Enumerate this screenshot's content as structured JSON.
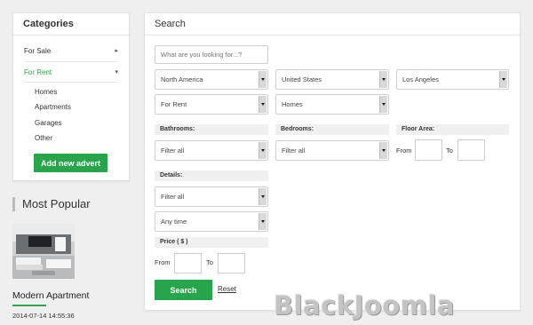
{
  "categories": {
    "title": "Categories",
    "items": [
      {
        "label": "For Sale",
        "arrow": "▸"
      },
      {
        "label": "For Rent",
        "arrow": "▾"
      }
    ],
    "subitems": [
      "Homes",
      "Apartments",
      "Garages",
      "Other"
    ],
    "add_button": "Add new advert"
  },
  "popular": {
    "title": "Most Popular",
    "article_title": "Modern Apartment",
    "article_date": "2014-07-14 14:55:36"
  },
  "search": {
    "title": "Search",
    "keyword_placeholder": "What are you looking for...?",
    "region": "North America",
    "country": "United States",
    "city": "Los Angeles",
    "listing_type": "For Rent",
    "property_type": "Homes",
    "bathrooms_label": "Bathrooms:",
    "bathrooms_value": "Filter all",
    "bedrooms_label": "Bedrooms:",
    "bedrooms_value": "Filter all",
    "floor_area_label": "Floor Area:",
    "from_label": "From",
    "to_label": "To",
    "details_label": "Details:",
    "details_value": "Filter all",
    "time_value": "Any time",
    "price_label": "Price ( $ )",
    "search_button": "Search",
    "reset_link": "Reset"
  },
  "watermark": "BlackJoomla",
  "colors": {
    "accent": "#27a54a",
    "panel_bg": "#ffffff",
    "page_bg": "#efefef"
  }
}
